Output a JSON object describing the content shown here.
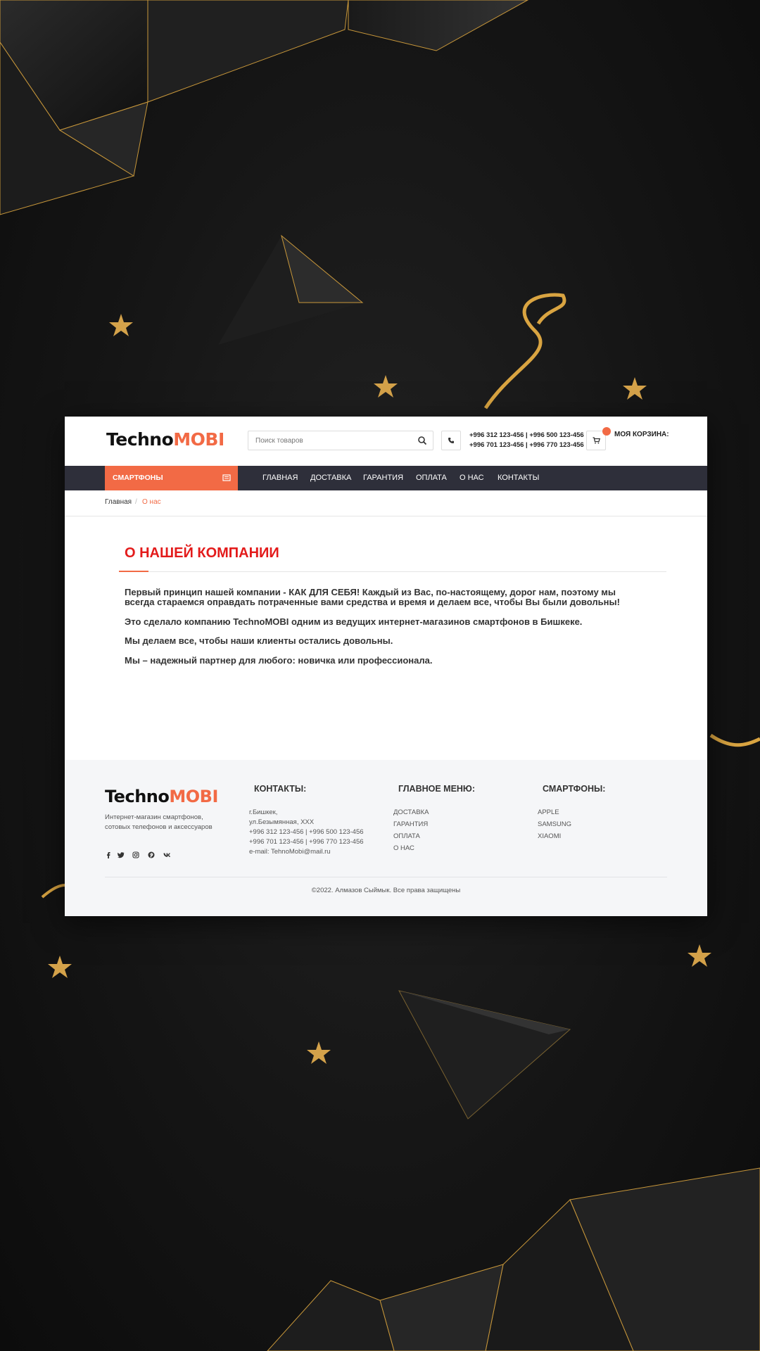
{
  "brand": {
    "part1": "Techno",
    "part2": "MOBI"
  },
  "header": {
    "search_placeholder": "Поиск товаров",
    "phone_line1": "+996 312 123-456 | +996 500 123-456",
    "phone_line2": "+996 701 123-456 | +996 770 123-456",
    "cart_label": "МОЯ КОРЗИНА:"
  },
  "nav": {
    "category_button": "СМАРТФОНЫ",
    "items": [
      "ГЛАВНАЯ",
      "ДОСТАВКА",
      "ГАРАНТИЯ",
      "ОПЛАТА",
      "О НАС",
      "КОНТАКТЫ"
    ]
  },
  "breadcrumb": {
    "home": "Главная",
    "separator": "/",
    "current": "О нас"
  },
  "content": {
    "title": "О НАШЕЙ КОМПАНИИ",
    "paragraphs": [
      "Первый принцип нашей компании - КАК ДЛЯ СЕБЯ! Каждый из Вас, по-настоящему, дорог нам, поэтому мы всегда стараемся оправдать потраченные вами средства и время и делаем все, чтобы Вы были довольны!",
      "Это сделало компанию TechnoMOBI одним из ведущих интернет-магазинов смартфонов в Бишкеке.",
      "Мы делаем все, чтобы наши клиенты остались довольны.",
      "Мы – надежный партнер для любого: новичка или профессионала."
    ]
  },
  "footer": {
    "description_line1": "Интернет-магазин смартфонов,",
    "description_line2": "сотовых телефонов и аксессуаров",
    "contacts": {
      "heading": "КОНТАКТЫ:",
      "lines": [
        "г.Бишкек,",
        "ул.Безымянная, ХХХ",
        "+996 312 123-456 | +996 500 123-456",
        "+996 701 123-456 | +996 770 123-456",
        "e-mail: TehnoMobi@mail.ru"
      ]
    },
    "menu": {
      "heading": "ГЛАВНОЕ МЕНЮ:",
      "items": [
        "ДОСТАВКА",
        "ГАРАНТИЯ",
        "ОПЛАТА",
        "О НАС"
      ]
    },
    "phones": {
      "heading": "СМАРТФОНЫ:",
      "items": [
        "APPLE",
        "SAMSUNG",
        "XIAOMI"
      ]
    },
    "social_icons": [
      "facebook-icon",
      "twitter-icon",
      "instagram-icon",
      "pinterest-icon",
      "vk-icon"
    ],
    "copyright": "©2022. Алмазов Сыймык. Все права защищены"
  },
  "colors": {
    "accent": "#f26a45",
    "title_red": "#e31b1b",
    "nav_bg": "#2e2f3a",
    "gold": "#d9a441",
    "background": "#151515"
  }
}
